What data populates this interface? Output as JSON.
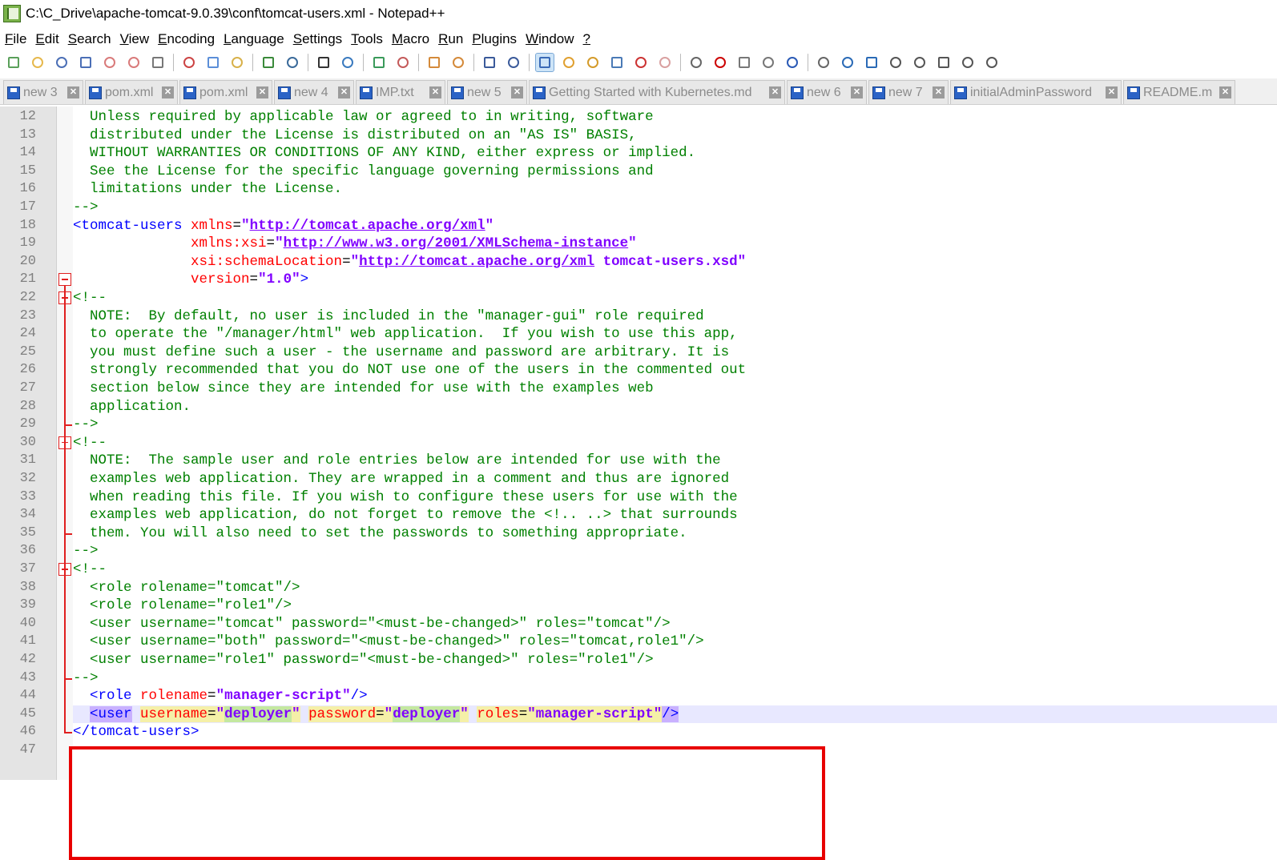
{
  "window": {
    "title": "C:\\C_Drive\\apache-tomcat-9.0.39\\conf\\tomcat-users.xml - Notepad++"
  },
  "menu": [
    {
      "u": "F",
      "rest": "ile"
    },
    {
      "u": "E",
      "rest": "dit"
    },
    {
      "u": "S",
      "rest": "earch"
    },
    {
      "u": "V",
      "rest": "iew"
    },
    {
      "u": "E",
      "rest": "ncoding",
      "pre": ""
    },
    {
      "u": "L",
      "rest": "anguage"
    },
    {
      "u": "S",
      "rest": "ettings",
      "pre": ""
    },
    {
      "u": "T",
      "rest": "ools"
    },
    {
      "u": "M",
      "rest": "acro"
    },
    {
      "u": "R",
      "rest": "un"
    },
    {
      "u": "P",
      "rest": "lugins"
    },
    {
      "u": "W",
      "rest": "indow"
    },
    {
      "u": "?",
      "rest": ""
    }
  ],
  "toolbar_icons": [
    "new-file-icon",
    "open-file-icon",
    "save-icon",
    "save-all-icon",
    "close-icon",
    "close-all-icon",
    "print-icon",
    "sep",
    "cut-icon",
    "copy-icon",
    "paste-icon",
    "sep",
    "undo-icon",
    "redo-icon",
    "sep",
    "find-icon",
    "replace-icon",
    "sep",
    "zoom-in-icon",
    "zoom-out-icon",
    "sep",
    "sync-vertical-icon",
    "sync-horizontal-icon",
    "sep",
    "word-wrap-icon",
    "show-all-chars-icon",
    "sep",
    "indent-guide-icon",
    "udl-icon",
    "doc-map-icon",
    "function-list-icon",
    "folder-workspace-icon",
    "monitoring-icon",
    "sep",
    "record-macro-icon",
    "stop-record-icon",
    "play-macro-icon",
    "run-macro-multiple-icon",
    "save-macro-icon",
    "sep",
    "icon-a",
    "icon-b",
    "icon-c",
    "icon-d",
    "icon-e",
    "icon-f",
    "icon-g",
    "icon-h"
  ],
  "tabs": [
    {
      "label": "new 3",
      "width": 100
    },
    {
      "label": "pom.xml",
      "width": 116
    },
    {
      "label": "pom.xml",
      "width": 116
    },
    {
      "label": "new 4",
      "width": 100
    },
    {
      "label": "IMP.txt",
      "width": 112
    },
    {
      "label": "new 5",
      "width": 100
    },
    {
      "label": "Getting Started with Kubernetes.md",
      "width": 320
    },
    {
      "label": "new 6",
      "width": 100
    },
    {
      "label": "new 7",
      "width": 100
    },
    {
      "label": "initialAdminPassword",
      "width": 214
    },
    {
      "label": "README.md",
      "width": 140
    }
  ],
  "editor": {
    "line_numbers": [
      "12",
      "13",
      "14",
      "15",
      "16",
      "17",
      "18",
      "19",
      "20",
      "21",
      "22",
      "23",
      "24",
      "25",
      "26",
      "27",
      "28",
      "29",
      "30",
      "31",
      "32",
      "33",
      "34",
      "35",
      "36",
      "37",
      "38",
      "39",
      "40",
      "41",
      "42",
      "43",
      "44",
      "45",
      "46",
      "47"
    ],
    "lines": [
      [
        {
          "t": "  Unless required by applicable law or agreed to in writing, software",
          "c": "c-comment"
        }
      ],
      [
        {
          "t": "  distributed under the License is distributed on an \"AS IS\" BASIS,",
          "c": "c-comment"
        }
      ],
      [
        {
          "t": "  WITHOUT WARRANTIES OR CONDITIONS OF ANY KIND, either express or implied.",
          "c": "c-comment"
        }
      ],
      [
        {
          "t": "  See the License for the specific language governing permissions and",
          "c": "c-comment"
        }
      ],
      [
        {
          "t": "  limitations under the License.",
          "c": "c-comment"
        }
      ],
      [
        {
          "t": "-->",
          "c": "c-comment"
        }
      ],
      [
        {
          "t": "<tomcat-users ",
          "c": "c-tag"
        },
        {
          "t": "xmlns",
          "c": "c-attr"
        },
        {
          "t": "=",
          "c": "c-plain"
        },
        {
          "t": "\"",
          "c": "c-val"
        },
        {
          "t": "http://tomcat.apache.org/xml",
          "c": "c-url"
        },
        {
          "t": "\"",
          "c": "c-val"
        }
      ],
      [
        {
          "t": "              ",
          "c": "c-plain"
        },
        {
          "t": "xmlns:xsi",
          "c": "c-attr"
        },
        {
          "t": "=",
          "c": "c-plain"
        },
        {
          "t": "\"",
          "c": "c-val"
        },
        {
          "t": "http://www.w3.org/2001/XMLSchema-instance",
          "c": "c-url"
        },
        {
          "t": "\"",
          "c": "c-val"
        }
      ],
      [
        {
          "t": "              ",
          "c": "c-plain"
        },
        {
          "t": "xsi:schemaLocation",
          "c": "c-attr"
        },
        {
          "t": "=",
          "c": "c-plain"
        },
        {
          "t": "\"",
          "c": "c-val"
        },
        {
          "t": "http://tomcat.apache.org/xml",
          "c": "c-url"
        },
        {
          "t": " tomcat-users.xsd\"",
          "c": "c-val"
        }
      ],
      [
        {
          "t": "              ",
          "c": "c-plain"
        },
        {
          "t": "version",
          "c": "c-attr"
        },
        {
          "t": "=",
          "c": "c-plain"
        },
        {
          "t": "\"1.0\"",
          "c": "c-val"
        },
        {
          "t": ">",
          "c": "c-tag"
        }
      ],
      [
        {
          "t": "<!--",
          "c": "c-comment"
        }
      ],
      [
        {
          "t": "  NOTE:  By default, no user is included in the \"manager-gui\" role required",
          "c": "c-comment"
        }
      ],
      [
        {
          "t": "  to operate the \"/manager/html\" web application.  If you wish to use this app,",
          "c": "c-comment"
        }
      ],
      [
        {
          "t": "  you must define such a user - the username and password are arbitrary. It is",
          "c": "c-comment"
        }
      ],
      [
        {
          "t": "  strongly recommended that you do NOT use one of the users in the commented out",
          "c": "c-comment"
        }
      ],
      [
        {
          "t": "  section below since they are intended for use with the examples web",
          "c": "c-comment"
        }
      ],
      [
        {
          "t": "  application.",
          "c": "c-comment"
        }
      ],
      [
        {
          "t": "-->",
          "c": "c-comment"
        }
      ],
      [
        {
          "t": "<!--",
          "c": "c-comment"
        }
      ],
      [
        {
          "t": "  NOTE:  The sample user and role entries below are intended for use with the",
          "c": "c-comment"
        }
      ],
      [
        {
          "t": "  examples web application. They are wrapped in a comment and thus are ignored",
          "c": "c-comment"
        }
      ],
      [
        {
          "t": "  when reading this file. If you wish to configure these users for use with the",
          "c": "c-comment"
        }
      ],
      [
        {
          "t": "  examples web application, do not forget to remove the <!.. ..> that surrounds",
          "c": "c-comment"
        }
      ],
      [
        {
          "t": "  them. You will also need to set the passwords to something appropriate.",
          "c": "c-comment"
        }
      ],
      [
        {
          "t": "-->",
          "c": "c-comment"
        }
      ],
      [
        {
          "t": "<!--",
          "c": "c-comment"
        }
      ],
      [
        {
          "t": "  <role rolename=\"tomcat\"/>",
          "c": "c-comment"
        }
      ],
      [
        {
          "t": "  <role rolename=\"role1\"/>",
          "c": "c-comment"
        }
      ],
      [
        {
          "t": "  <user username=\"tomcat\" password=\"<must-be-changed>\" roles=\"tomcat\"/>",
          "c": "c-comment"
        }
      ],
      [
        {
          "t": "  <user username=\"both\" password=\"<must-be-changed>\" roles=\"tomcat,role1\"/>",
          "c": "c-comment"
        }
      ],
      [
        {
          "t": "  <user username=\"role1\" password=\"<must-be-changed>\" roles=\"role1\"/>",
          "c": "c-comment"
        }
      ],
      [
        {
          "t": "-->",
          "c": "c-comment"
        }
      ],
      [
        {
          "t": "  ",
          "c": "c-plain"
        },
        {
          "t": "<role ",
          "c": "c-tag"
        },
        {
          "t": "rolename",
          "c": "c-attr"
        },
        {
          "t": "=",
          "c": "c-plain"
        },
        {
          "t": "\"manager-script\"",
          "c": "c-val"
        },
        {
          "t": "/>",
          "c": "c-tag"
        }
      ],
      [
        {
          "t": "  ",
          "c": "c-plain"
        },
        {
          "t": "<user",
          "c": "c-tag",
          "h": "ht"
        },
        {
          "t": " ",
          "c": "c-plain"
        },
        {
          "t": "username",
          "c": "c-attr",
          "h": "ha"
        },
        {
          "t": "=",
          "c": "c-plain",
          "h": "ha"
        },
        {
          "t": "\"",
          "c": "c-val",
          "h": "ha"
        },
        {
          "t": "deployer",
          "c": "c-val",
          "h": "hv"
        },
        {
          "t": "\"",
          "c": "c-val",
          "h": "ha"
        },
        {
          "t": " ",
          "c": "c-plain"
        },
        {
          "t": "password",
          "c": "c-attr",
          "h": "ha"
        },
        {
          "t": "=",
          "c": "c-plain",
          "h": "ha"
        },
        {
          "t": "\"",
          "c": "c-val",
          "h": "ha"
        },
        {
          "t": "deployer",
          "c": "c-val",
          "h": "hv"
        },
        {
          "t": "\"",
          "c": "c-val",
          "h": "ha"
        },
        {
          "t": " ",
          "c": "c-plain"
        },
        {
          "t": "roles",
          "c": "c-attr",
          "h": "ha"
        },
        {
          "t": "=",
          "c": "c-plain",
          "h": "ha"
        },
        {
          "t": "\"manager-script\"",
          "c": "c-val",
          "h": "ha"
        },
        {
          "t": "/>",
          "c": "c-tag",
          "h": "ht"
        }
      ],
      [
        {
          "t": "</tomcat-users>",
          "c": "c-tag"
        }
      ],
      [
        {
          "t": "",
          "c": "c-plain"
        }
      ]
    ]
  },
  "colors": {
    "highlight_box": "#e80000",
    "fold_marker": "#e01f1f",
    "active_line": "#e8e8ff"
  }
}
